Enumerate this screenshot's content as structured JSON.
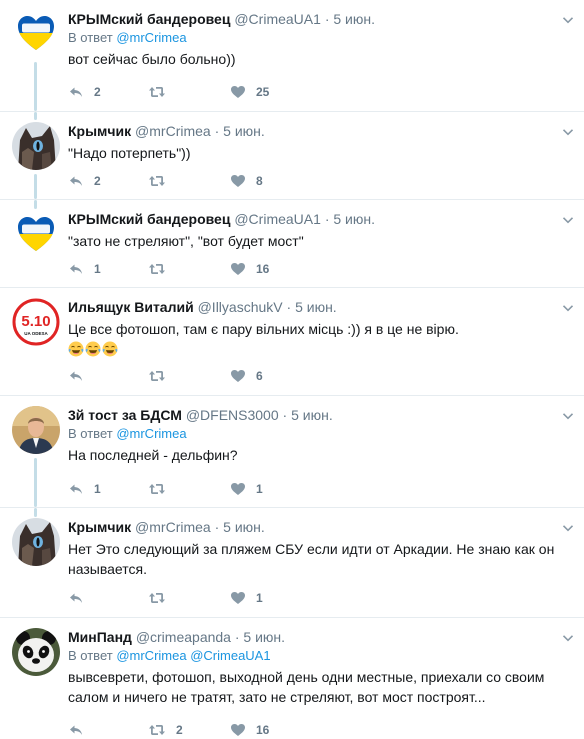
{
  "tweets": [
    {
      "name": "КРЫМский бандеровец",
      "handle": "@CrimeaUA1",
      "time": "5 июн.",
      "reply_prefix": "В ответ",
      "reply_mentions": [
        "@mrCrimea"
      ],
      "text": "вот сейчас было больно))",
      "replies": "2",
      "retweets": "",
      "likes": "25",
      "avatar": "krym-ukraina-heart-logo"
    },
    {
      "name": "Крымчик",
      "handle": "@mrCrimea",
      "time": "5 июн.",
      "reply_prefix": "",
      "reply_mentions": [],
      "text": "\"Надо потерпеть\"))",
      "replies": "2",
      "retweets": "",
      "likes": "8",
      "avatar": "cat-photo"
    },
    {
      "name": "КРЫМский бандеровец",
      "handle": "@CrimeaUA1",
      "time": "5 июн.",
      "reply_prefix": "",
      "reply_mentions": [],
      "text": "\"зато не стреляют\", \"вот будет мост\"",
      "replies": "1",
      "retweets": "",
      "likes": "16",
      "avatar": "krym-ukraina-heart-logo"
    },
    {
      "name": "Ильящук Виталий",
      "handle": "@IllyaschukV",
      "time": "5 июн.",
      "reply_prefix": "",
      "reply_mentions": [],
      "text": "Це все фотошоп, там є пару вільних місць :)) я в це не вірю.",
      "emoji_count": 3,
      "replies": "",
      "retweets": "",
      "likes": "6",
      "avatar": "5-10-ua-odesa-logo",
      "avatar_text": "5.10",
      "avatar_subtext": "UA ODESA"
    },
    {
      "name": "3й тост за БДСМ",
      "handle": "@DFENS3000",
      "time": "5 июн.",
      "reply_prefix": "В ответ",
      "reply_mentions": [
        "@mrCrimea"
      ],
      "text": "На последней - дельфин?",
      "replies": "1",
      "retweets": "",
      "likes": "1",
      "avatar": "man-in-suit-photo"
    },
    {
      "name": "Крымчик",
      "handle": "@mrCrimea",
      "time": "5 июн.",
      "reply_prefix": "",
      "reply_mentions": [],
      "text": "Нет  Это следующий за пляжем СБУ если идти от Аркадии. Не знаю как он называется.",
      "replies": "",
      "retweets": "",
      "likes": "1",
      "avatar": "cat-photo"
    },
    {
      "name": "МинПанд",
      "handle": "@crimeapanda",
      "time": "5 июн.",
      "reply_prefix": "В ответ",
      "reply_mentions": [
        "@mrCrimea",
        "@CrimeaUA1"
      ],
      "text": "вывсеврети, фотошоп, выходной день одни местные, приехали со своим салом и ничего не тратят, зато не стреляют, вот мост построят...",
      "replies": "",
      "retweets": "2",
      "likes": "16",
      "avatar": "panda-photo"
    }
  ],
  "colors": {
    "text": "#14171a",
    "secondary": "#657786",
    "link": "#1b95e0",
    "divider": "#e6ecf0",
    "thread_line": "#c4dde7",
    "icon": "#8899a6"
  },
  "icons": {
    "reply": "reply-icon",
    "retweet": "retweet-icon",
    "like": "heart-icon",
    "caret": "chevron-down-icon"
  }
}
